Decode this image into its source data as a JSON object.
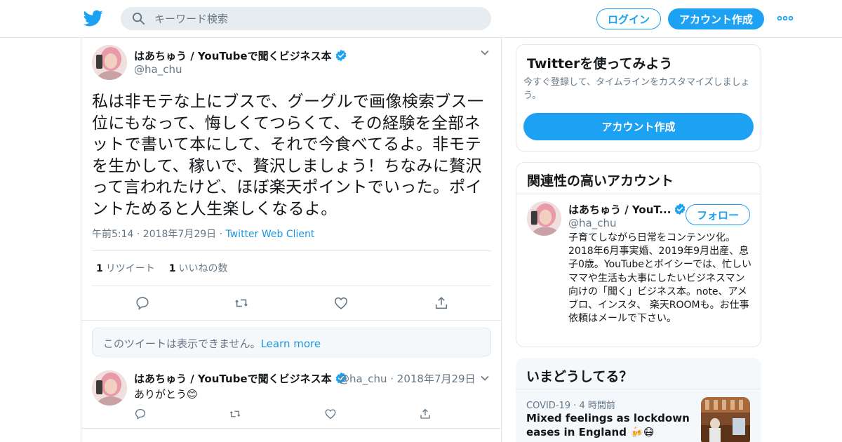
{
  "topbar": {
    "search_placeholder": "キーワード検索",
    "login_label": "ログイン",
    "signup_label": "アカウント作成",
    "more_icon": "more-dots-icon",
    "logo_icon": "twitter-bird-icon"
  },
  "tweet": {
    "author_name": "はあちゅう / YouTubeで聞くビジネス本",
    "author_handle": "@ha_chu",
    "text": "私は非モテな上にブスで、グーグルで画像検索ブス一位にもなって、悔しくてつらくて、その経験を全部ネットで書いて本にして、それで今食べてるよ。非モテを生かして、稼いで、贅沢しましょう！ちなみに贅沢って言われたけど、ほぼ楽天ポイントでいった。ポイントためると人生楽しくなるよ。",
    "time": "午前5:14 · 2018年7月29日 · ",
    "client": "Twitter Web Client",
    "retweet_count": "1",
    "retweet_label": "リツイート",
    "like_count": "1",
    "like_label": "いいねの数"
  },
  "unavailable": {
    "text": "このツイートは表示できません。",
    "link": "Learn more"
  },
  "reply": {
    "author_name": "はあちゅう / YouTubeで聞くビジネス本",
    "author_handle": "@ha_chu",
    "date": "· 2018年7月29日",
    "text": "ありがとう😊"
  },
  "sidebar": {
    "try_title": "Twitterを使ってみよう",
    "try_desc": "今すぐ登録して、タイムラインをカスタマイズしましょう。",
    "try_button": "アカウント作成",
    "related_title": "関連性の高いアカウント",
    "related_name": "はあちゅう / YouT...",
    "related_handle": "@ha_chu",
    "follow_label": "フォロー",
    "related_bio": "子育てしながら日常をコンテンツ化。2018年6月事実婚、2019年9月出産、息子0歳。YouTubeとボイシーでは、忙しいママや生活も大事にしたいビジネスマン向けの「聞く」ビジネス本。note、アメブロ、インスタ、 楽天ROOMも。お仕事依頼はメールで下さい。",
    "trends_title": "いまどうしてる？",
    "trend_meta": "COVID-19 · 4 時間前",
    "trend_title": "Mixed feelings as lockdown eases in England 🍻😷"
  },
  "colors": {
    "accent": "#1da1f2",
    "link": "#1b95e0",
    "muted": "#657786",
    "border": "#e1e8ed"
  }
}
